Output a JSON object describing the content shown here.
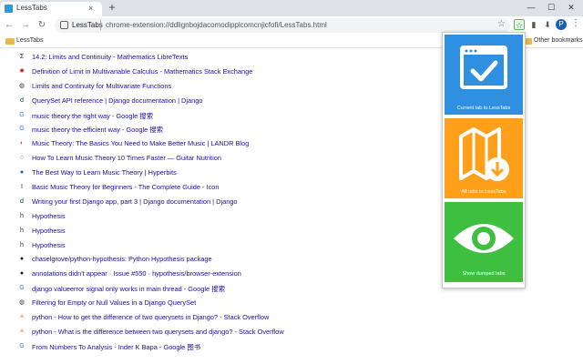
{
  "browser": {
    "tab_title": "LessTabs",
    "tab_close": "×",
    "new_tab": "+",
    "window_controls": [
      "—",
      "☐",
      "✕"
    ],
    "omnibox_site": "LessTabs",
    "omnibox_url": "chrome-extension://ddlignbojdacomodipplcomcnjicfofi/LessTabs.html",
    "profile_initial": "P"
  },
  "bookmarks": {
    "left": "LessTabs",
    "right": "Other bookmarks"
  },
  "links": [
    {
      "text": "14.2: Limits and Continuity - Mathematics LibreTexts",
      "icon": "sigma-icon",
      "glyph": "Σ",
      "color": "#222222"
    },
    {
      "text": "Definition of Limit in Multivariable Calculus - Mathematics Stack Exchange",
      "icon": "math-se-icon",
      "glyph": "✹",
      "color": "#c62828"
    },
    {
      "text": "Limits and Continuity for Multivariate Functions",
      "icon": "globe-icon",
      "glyph": "◍",
      "color": "#333333"
    },
    {
      "text": "QuerySet API reference | Django documentation | Django",
      "icon": "django-icon",
      "glyph": "d",
      "color": "#0c4b33"
    },
    {
      "text": "music theory the right way - Google 搜索",
      "icon": "google-icon",
      "glyph": "G",
      "color": "#4285f4"
    },
    {
      "text": "music theory the efficient way - Google 搜索",
      "icon": "google-icon",
      "glyph": "G",
      "color": "#4285f4"
    },
    {
      "text": "Music Theory: The Basics You Need to Make Better Music | LANDR Blog",
      "icon": "landr-icon",
      "glyph": "◐",
      "color": "#e04060"
    },
    {
      "text": "How To Learn Music Theory 10 Times Faster — Guitar Nutrition",
      "icon": "circle-icon",
      "glyph": "○",
      "color": "#2e7d32"
    },
    {
      "text": "The Best Way to Learn Music Theory | Hyperbits",
      "icon": "hyperbits-icon",
      "glyph": "●",
      "color": "#1565c0"
    },
    {
      "text": "Basic Music Theory for Beginners - The Complete Guide - Icon",
      "icon": "icon-site-icon",
      "glyph": "I",
      "color": "#333333"
    },
    {
      "text": "Writing your first Django app, part 3 | Django documentation | Django",
      "icon": "django-icon",
      "glyph": "d",
      "color": "#0c4b33"
    },
    {
      "text": "Hypothesis",
      "icon": "hypothesis-icon",
      "glyph": "h",
      "color": "#333333"
    },
    {
      "text": "Hypothesis",
      "icon": "hypothesis-icon",
      "glyph": "h",
      "color": "#333333"
    },
    {
      "text": "Hypothesis",
      "icon": "hypothesis-icon",
      "glyph": "h",
      "color": "#333333"
    },
    {
      "text": "chaselgrove/python-hypothesis: Python Hypothesis package",
      "icon": "github-icon",
      "glyph": "●",
      "color": "#222222"
    },
    {
      "text": "annotations didn't appear · Issue #550 · hypothesis/browser-extension",
      "icon": "github-icon",
      "glyph": "●",
      "color": "#222222"
    },
    {
      "text": "django valueerror signal only works in main thread - Google 搜索",
      "icon": "google-icon",
      "glyph": "G",
      "color": "#4285f4"
    },
    {
      "text": "Filtering for Empty or Null Values in a Django QuerySet",
      "icon": "globe-icon",
      "glyph": "◍",
      "color": "#333333"
    },
    {
      "text": "python - How to get the difference of two querysets in Django? - Stack Overflow",
      "icon": "stackoverflow-icon",
      "glyph": "≡",
      "color": "#f48024"
    },
    {
      "text": "python - What is the difference between two querysets and django? - Stack Overflow",
      "icon": "stackoverflow-icon",
      "glyph": "≡",
      "color": "#f48024"
    },
    {
      "text": "From Numbers To Analysis - Inder K Bapa - Google 图书",
      "icon": "google-icon",
      "glyph": "G",
      "color": "#4285f4"
    }
  ],
  "popup": {
    "buttons": [
      {
        "label": "Current tab to LessTabs",
        "color": "#2f8fe0",
        "icon": "window-check-icon"
      },
      {
        "label": "All tabs to LessTabs",
        "color": "#ff9f1a",
        "icon": "map-download-icon"
      },
      {
        "label": "Show dumped tabs",
        "color": "#3fbf3f",
        "icon": "eye-icon"
      }
    ]
  }
}
